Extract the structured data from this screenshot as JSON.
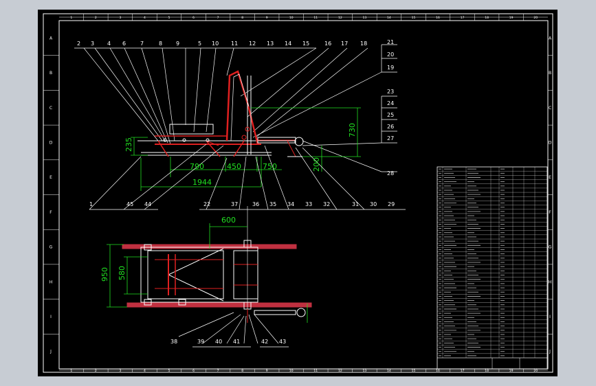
{
  "border": {
    "top_numbers": [
      "1",
      "2",
      "3",
      "4",
      "5",
      "6",
      "7",
      "8",
      "9",
      "10",
      "11",
      "12",
      "13",
      "14",
      "15",
      "16",
      "17",
      "18",
      "19",
      "20"
    ],
    "side_letters": [
      "A",
      "B",
      "C",
      "D",
      "E",
      "F",
      "G",
      "H",
      "I",
      "J"
    ]
  },
  "side_view": {
    "top_callouts": [
      "2",
      "3",
      "4",
      "6",
      "7",
      "8",
      "9",
      "5",
      "10",
      "11",
      "12",
      "13",
      "14",
      "15",
      "16",
      "17",
      "18"
    ],
    "right_callouts": [
      "21",
      "20",
      "19",
      "23",
      "24",
      "25",
      "26",
      "27",
      "28"
    ],
    "bottom_callouts": [
      "1",
      "45",
      "44",
      "22",
      "37",
      "36",
      "35",
      "34",
      "33",
      "32",
      "31",
      "30",
      "29"
    ],
    "dimensions": {
      "h235": "235",
      "h730": "730",
      "h200": "200",
      "w790": "790",
      "w450": "450",
      "w750": "750",
      "w1944": "1944"
    }
  },
  "top_view": {
    "callouts": [
      "38",
      "39",
      "40",
      "41",
      "42",
      "43"
    ],
    "dimensions": {
      "w600": "600",
      "h950": "950",
      "h580": "580"
    }
  },
  "colors": {
    "frame": "#ffffff",
    "dimension": "#21e021",
    "part": "#e02020",
    "red_bar": "#c03040",
    "leader": "#ffffff"
  }
}
